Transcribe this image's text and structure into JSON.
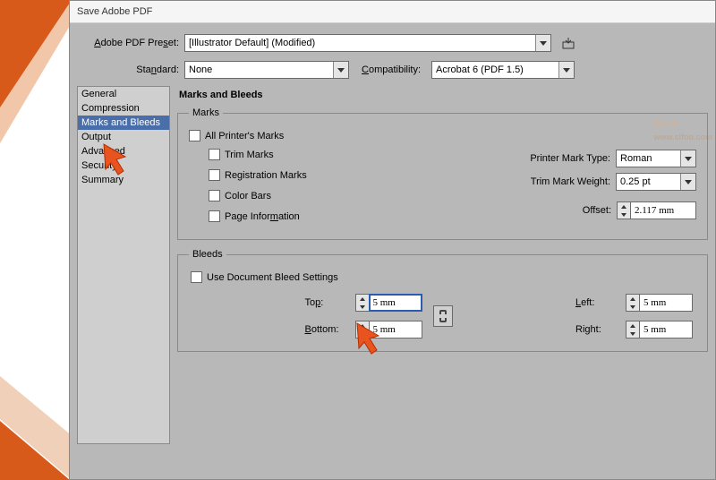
{
  "window": {
    "title": "Save Adobe PDF"
  },
  "preset": {
    "label": "Adobe PDF Preset:",
    "value": "[Illustrator Default] (Modified)"
  },
  "standard": {
    "label": "Standard:",
    "value": "None"
  },
  "compatibility": {
    "label": "Compatibility:",
    "value": "Acrobat 6 (PDF 1.5)"
  },
  "sidebar": {
    "items": [
      {
        "label": "General"
      },
      {
        "label": "Compression"
      },
      {
        "label": "Marks and Bleeds"
      },
      {
        "label": "Output"
      },
      {
        "label": "Advanced"
      },
      {
        "label": "Security"
      },
      {
        "label": "Summary"
      }
    ],
    "selected_index": 2
  },
  "section": {
    "title": "Marks and Bleeds"
  },
  "marks": {
    "legend": "Marks",
    "all_label": "All Printer's Marks",
    "trim_label": "Trim Marks",
    "reg_label": "Registration Marks",
    "color_label": "Color Bars",
    "pageinfo_label": "Page Information",
    "type_label": "Printer Mark Type:",
    "type_value": "Roman",
    "weight_label": "Trim Mark Weight:",
    "weight_value": "0.25 pt",
    "offset_label": "Offset:",
    "offset_value": "2.117 mm"
  },
  "bleeds": {
    "legend": "Bleeds",
    "usedoc_label": "Use Document Bleed Settings",
    "top_label": "Top:",
    "top_value": "5 mm",
    "bottom_label": "Bottom:",
    "bottom_value": "5 mm",
    "left_label": "Left:",
    "left_value": "5 mm",
    "right_label": "Right:",
    "right_value": "5 mm"
  },
  "watermark": {
    "brand": "Sifoo",
    "sub": "www.sifoo.com"
  }
}
